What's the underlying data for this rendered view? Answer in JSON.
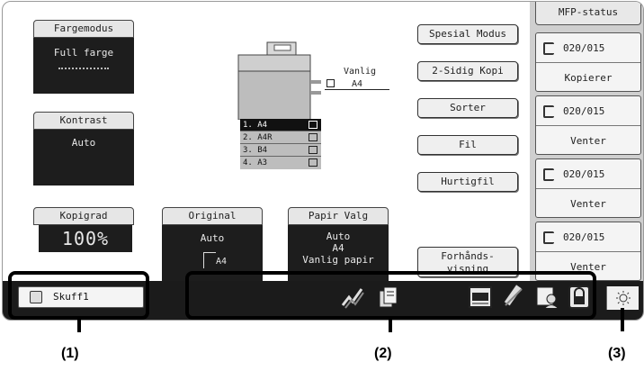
{
  "color_mode": {
    "label": "Fargemodus",
    "value": "Full farge"
  },
  "contrast": {
    "label": "Kontrast",
    "value": "Auto"
  },
  "copy_count": {
    "label": "Kopigrad",
    "value": "100%"
  },
  "original": {
    "label": "Original",
    "value": "Auto",
    "size": "A4"
  },
  "paper_select": {
    "label": "Papir Valg",
    "mode": "Auto",
    "size": "A4",
    "type": "Vanlig papir"
  },
  "output_tray": {
    "type": "Vanlig",
    "size": "A4"
  },
  "trays": [
    {
      "label": "1.  A4"
    },
    {
      "label": "2.  A4R"
    },
    {
      "label": "3.  B4"
    },
    {
      "label": "4.  A3"
    }
  ],
  "mode_buttons": {
    "special": "Spesial Modus",
    "duplex": "2-Sidig Kopi",
    "sort": "Sorter",
    "file": "Fil",
    "quick_file": "Hurtigfil",
    "preview": "Forhånds-\nvisning"
  },
  "mfp_status": {
    "title": "MFP-status",
    "jobs": [
      {
        "count": "020/015",
        "state": "Kopierer"
      },
      {
        "count": "020/015",
        "state": "Venter"
      },
      {
        "count": "020/015",
        "state": "Venter"
      },
      {
        "count": "020/015",
        "state": "Venter"
      }
    ]
  },
  "bottom_bar": {
    "tray_label": "Skuff1"
  },
  "callouts": {
    "c1": "(1)",
    "c2": "(2)",
    "c3": "(3)"
  },
  "colors": {
    "panel_dark": "#1d1d1d",
    "status_bg": "#cfcfcf",
    "frame": "#000000"
  }
}
